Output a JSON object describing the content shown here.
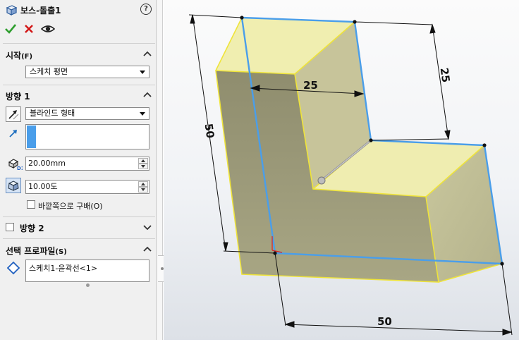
{
  "panel": {
    "title": "보스-돌출1",
    "help_label": "?",
    "sections": {
      "start": {
        "title": "시작",
        "key": "(F)",
        "dropdown_value": "스케치 평면"
      },
      "direction1": {
        "title": "방향 1",
        "end_condition_value": "블라인드 형태",
        "depth_value": "20.00mm",
        "draft_angle_value": "10.00도",
        "draft_outward_label": "바깥쪽으로 구배(O)"
      },
      "direction2": {
        "title": "방향 2"
      },
      "selected_profiles": {
        "title": "선택 프로파일",
        "key": "(S)",
        "items": [
          "스케치1-윤곽선<1>"
        ]
      }
    }
  },
  "viewport": {
    "dimensions": {
      "top_width": "25",
      "top_depth": "25",
      "left_height": "50",
      "bottom_width": "50"
    }
  },
  "icons": [
    "part-icon",
    "ok-check-icon",
    "cancel-x-icon",
    "preview-eye-icon",
    "reverse-direction-icon",
    "direction-arrow-icon",
    "depth-icon",
    "draft-icon",
    "profile-diamond-icon",
    "chevron-up-icon",
    "chevron-down-icon"
  ],
  "colors": {
    "ok_green": "#2e9e2e",
    "cancel_red": "#d21414",
    "sketch_blue": "#4a9eea",
    "edge_yellow": "#f0e640",
    "face_front": "#a4a27e",
    "face_top": "#f2f0b2",
    "face_side": "#c8c69c"
  }
}
